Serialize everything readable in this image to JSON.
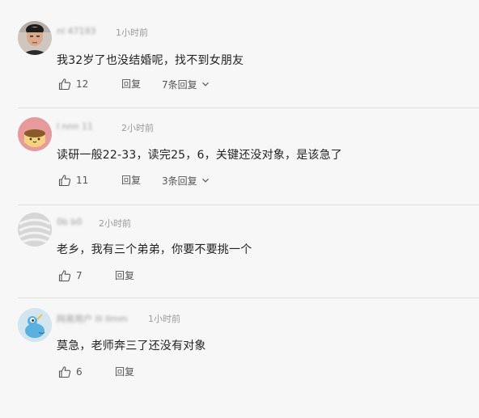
{
  "comments": [
    {
      "username": "nl 47193",
      "time": "1小时前",
      "text": "我32岁了也没结婚呢，找不到女朋友",
      "likes": "12",
      "reply_label": "回复",
      "replies_label": "7条回复",
      "avatar": "man-photo"
    },
    {
      "username": "l  nnn  11",
      "time": "2小时前",
      "text": "读研一般22-33，读完25，6，关键还没对象，是该急了",
      "likes": "11",
      "reply_label": "回复",
      "replies_label": "3条回复",
      "avatar": "cartoon-pudding"
    },
    {
      "username": "0b b0",
      "time": "2小时前",
      "text": "老乡，我有三个弟弟，你要不要挑一个",
      "likes": "7",
      "reply_label": "回复",
      "avatar": "default-gray"
    },
    {
      "username": "网易用户 lll llmm",
      "time": "1小时前",
      "text": "莫急，老师奔三了还没有对象",
      "likes": "6",
      "reply_label": "回复",
      "avatar": "cartoon-creature"
    }
  ],
  "icons": {
    "like": "thumbs-up-icon",
    "expand": "chevron-down-icon"
  },
  "colors": {
    "background": "#f7f7f7",
    "text": "#222222",
    "meta": "#9a9a9a",
    "action": "#555555",
    "divider": "#dedede"
  }
}
